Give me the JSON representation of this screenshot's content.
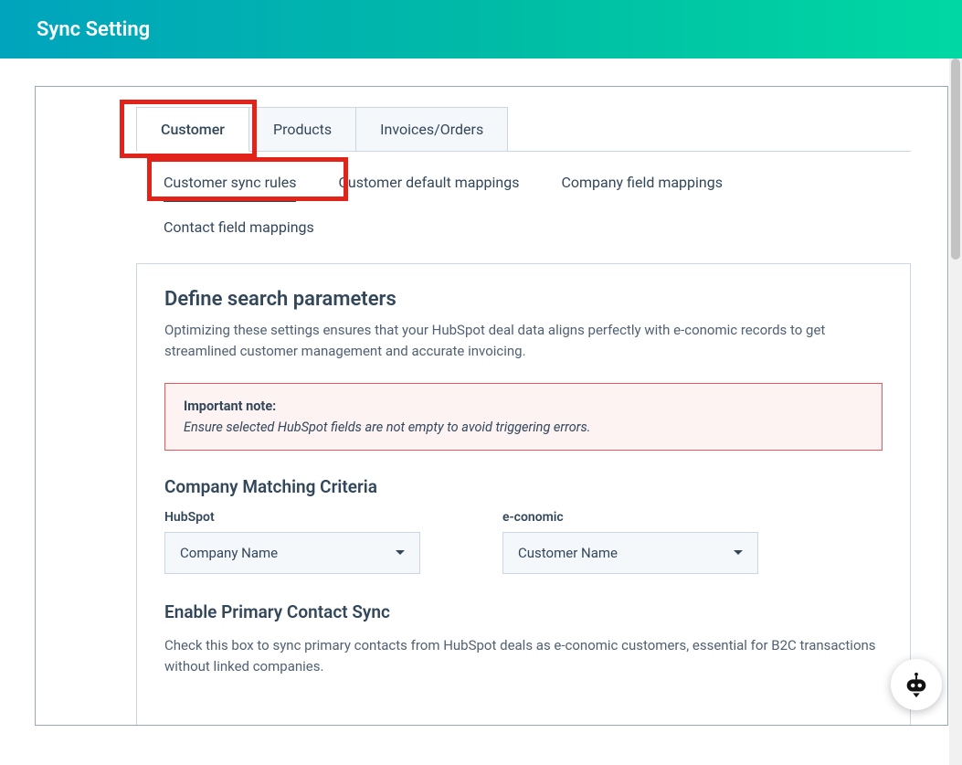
{
  "header": {
    "title": "Sync Setting"
  },
  "tabs": {
    "items": [
      {
        "label": "Customer",
        "active": true
      },
      {
        "label": "Products",
        "active": false
      },
      {
        "label": "Invoices/Orders",
        "active": false
      }
    ]
  },
  "subtabs": {
    "row1": [
      {
        "label": "Customer sync rules",
        "active": true
      },
      {
        "label": "Customer default mappings",
        "active": false
      },
      {
        "label": "Company field mappings",
        "active": false
      }
    ],
    "row2": [
      {
        "label": "Contact field mappings"
      }
    ]
  },
  "section1": {
    "title": "Define search parameters",
    "desc": "Optimizing these settings ensures that your HubSpot deal data aligns perfectly with e-conomic records to get streamlined customer management and accurate invoicing."
  },
  "note": {
    "title": "Important note:",
    "body": "Ensure selected HubSpot fields are not empty to avoid triggering errors."
  },
  "matching": {
    "title": "Company Matching Criteria",
    "left_label": "HubSpot",
    "right_label": "e-conomic",
    "left_value": "Company Name",
    "right_value": "Customer Name"
  },
  "section2": {
    "title": "Enable Primary Contact Sync",
    "desc": "Check this box to sync primary contacts from HubSpot deals as e-conomic customers, essential for B2C transactions without linked companies."
  },
  "highlight_color": "#e2231a"
}
